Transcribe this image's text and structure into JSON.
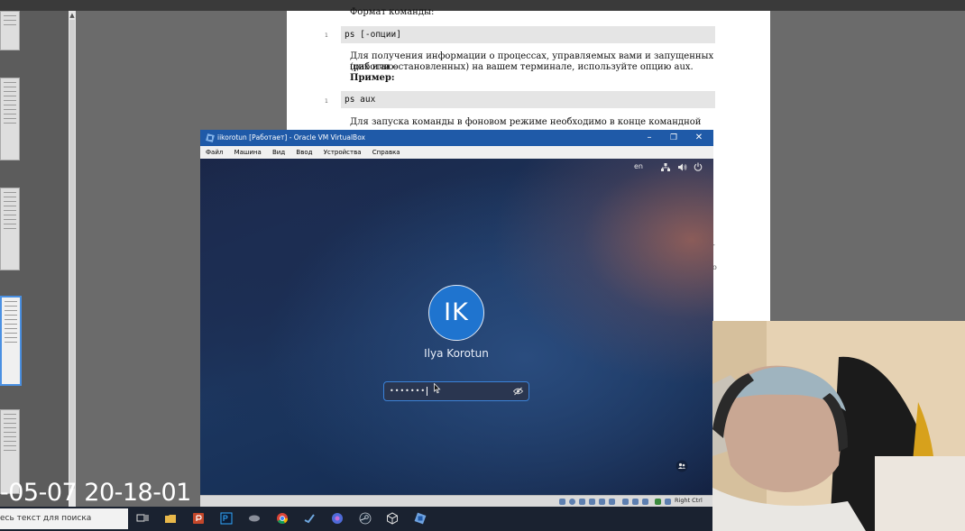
{
  "doc": {
    "line_format": "Формат команды:",
    "code1": "ps [-опции]",
    "para1_l1": "Для получения информации о процессах, управляемых вами и запущенных (работаю-",
    "para1_l2": "щих или остановленных) на вашем терминале, используйте опцию aux.",
    "example_label": "Пример:",
    "code2": "ps aux",
    "para2_l1": "Для запуска команды в фоновом режиме необходимо в конце командной строки ука-"
  },
  "vbox": {
    "title": "iikorotun [Работает] - Oracle VM VirtualBox",
    "menu": [
      "Файл",
      "Машина",
      "Вид",
      "Ввод",
      "Устройства",
      "Справка"
    ],
    "status_right": "Right Ctrl"
  },
  "login": {
    "language": "en",
    "avatar_initials": "IK",
    "user_name": "Ilya Korotun",
    "password_mask": "•••••••"
  },
  "timestamp": "-05-07 20-18-01",
  "taskbar": {
    "search_text": "есь текст для поиска"
  },
  "colors": {
    "vbox_titlebar": "#1f5aa8",
    "avatar": "#1f74cf",
    "taskbar": "#1a2230",
    "selection": "#4a90e2"
  },
  "icons": [
    "vbox-app-icon",
    "minimize-icon",
    "maximize-icon",
    "close-icon",
    "network-icon",
    "volume-icon",
    "power-icon",
    "eye-hidden-icon",
    "mouse-cursor-icon",
    "user-switch-icon",
    "task-view-icon",
    "file-explorer-icon",
    "powerpoint-icon",
    "photoshop-icon",
    "chrome-icon",
    "steam-icon",
    "virtualbox-icon"
  ]
}
